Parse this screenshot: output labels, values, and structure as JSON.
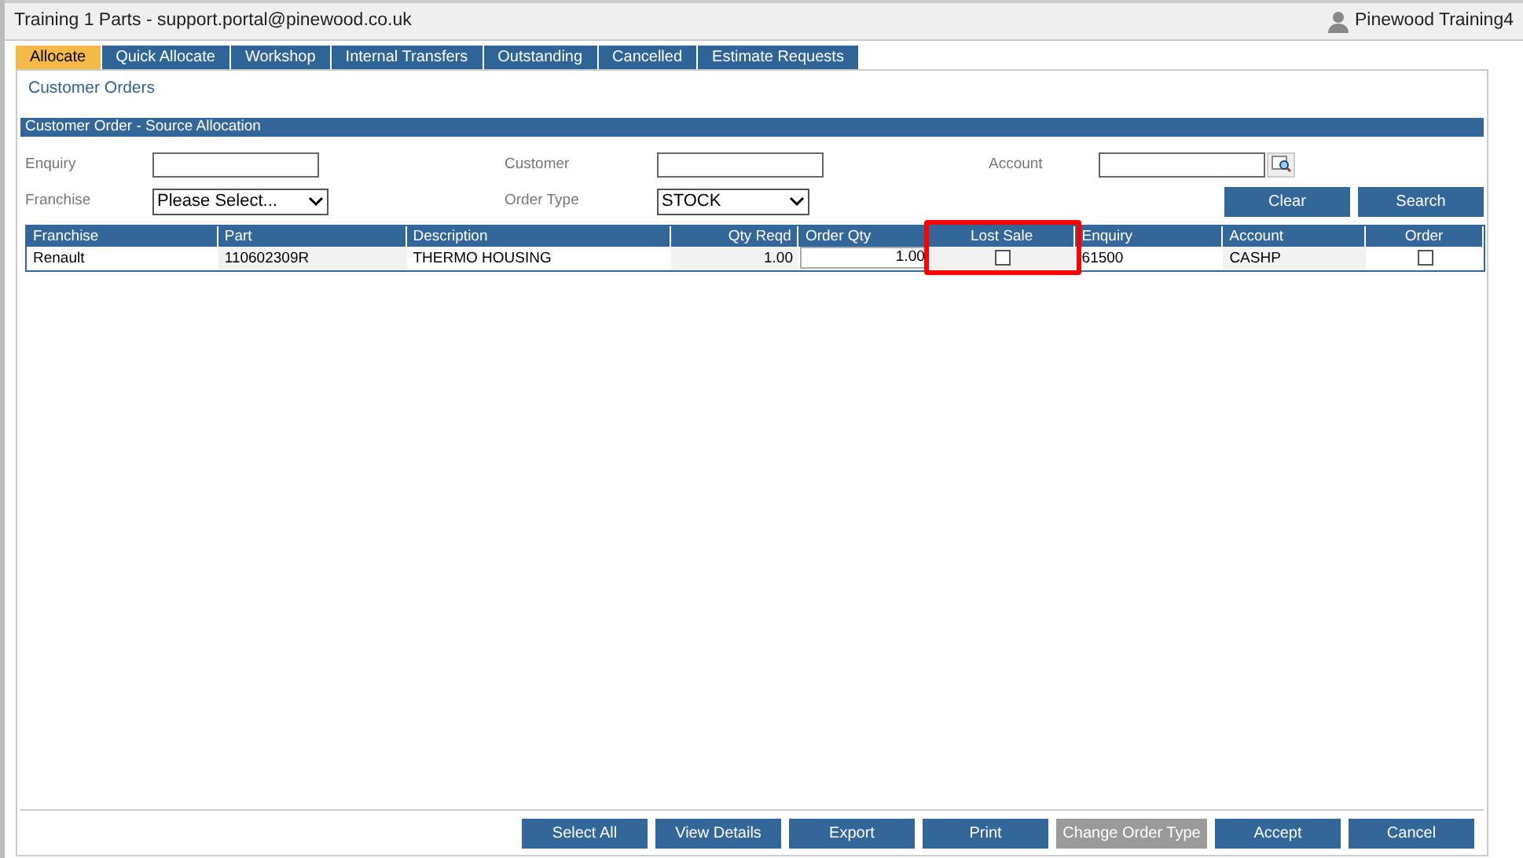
{
  "window": {
    "title": "Training 1 Parts - support.portal@pinewood.co.uk",
    "user": "Pinewood Training4"
  },
  "tabs": [
    {
      "label": "Allocate",
      "selected": true
    },
    {
      "label": "Quick Allocate",
      "selected": false
    },
    {
      "label": "Workshop",
      "selected": false
    },
    {
      "label": "Internal Transfers",
      "selected": false
    },
    {
      "label": "Outstanding",
      "selected": false
    },
    {
      "label": "Cancelled",
      "selected": false
    },
    {
      "label": "Estimate Requests",
      "selected": false
    }
  ],
  "page_title": "Customer Orders",
  "section_title": "Customer Order - Source Allocation",
  "filters": {
    "enquiry": {
      "label": "Enquiry"
    },
    "customer": {
      "label": "Customer"
    },
    "account": {
      "label": "Account"
    },
    "franchise": {
      "label": "Franchise",
      "value": "Please Select..."
    },
    "order_type": {
      "label": "Order Type",
      "value": "STOCK"
    }
  },
  "filter_buttons": [
    "Clear",
    "Search"
  ],
  "table": {
    "columns": [
      {
        "label": "Franchise"
      },
      {
        "label": "Part"
      },
      {
        "label": "Description"
      },
      {
        "label": "Qty Reqd"
      },
      {
        "label": "Order Qty"
      },
      {
        "label": "Lost Sale"
      },
      {
        "label": "Enquiry"
      },
      {
        "label": "Account"
      },
      {
        "label": "Order"
      }
    ],
    "rows": [
      {
        "franchise": "Renault",
        "part": "110602309R",
        "description": "THERMO HOUSING",
        "qty_reqd": "1.00",
        "order_qty": "1.00",
        "lost_sale": false,
        "enquiry": "61500",
        "account": "CASHP",
        "order": false
      }
    ]
  },
  "buttons": [
    {
      "label": "Select All",
      "disabled": false
    },
    {
      "label": "View Details",
      "disabled": false
    },
    {
      "label": "Export",
      "disabled": false
    },
    {
      "label": "Print",
      "disabled": false
    },
    {
      "label": "Change Order Type",
      "disabled": true
    },
    {
      "label": "Accept",
      "disabled": false
    },
    {
      "label": "Cancel",
      "disabled": false
    }
  ]
}
